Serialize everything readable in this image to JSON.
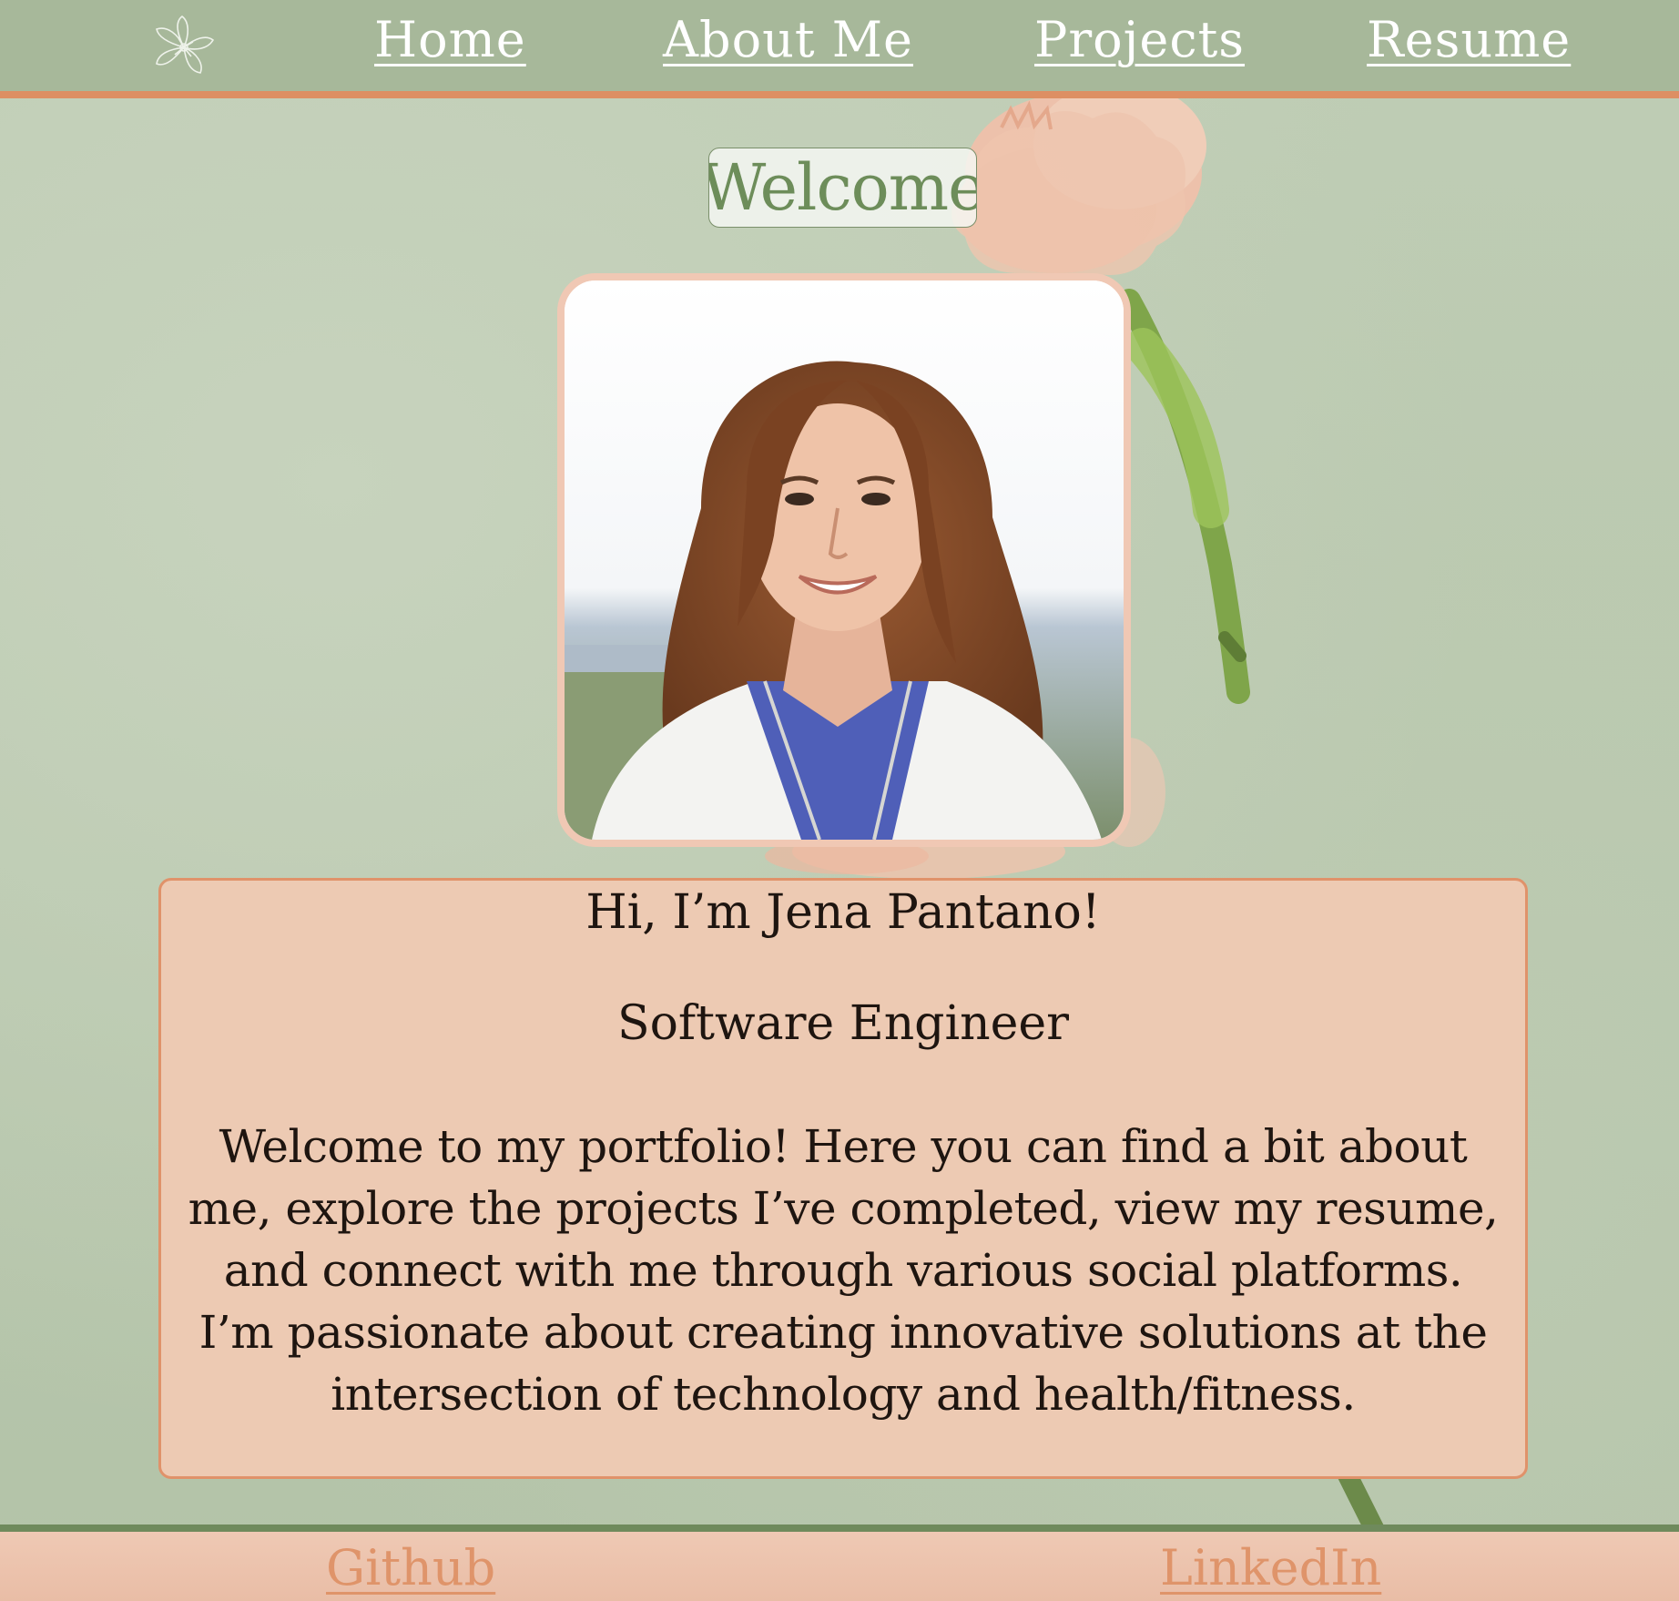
{
  "nav": {
    "logo_icon": "flower-logo-icon",
    "home_label": "Home",
    "about_label": "About Me",
    "projects_label": "Projects",
    "resume_label": "Resume"
  },
  "hero": {
    "welcome_label": "Welcome",
    "portrait_alt": "Jena Pantano portrait"
  },
  "intro": {
    "greeting": "Hi, I’m Jena Pantano!",
    "role": "Software Engineer",
    "body": "Welcome to my portfolio! Here you can find a bit about me, explore the projects I’ve completed, view my resume, and connect with me through various social platforms. I’m passionate about creating innovative solutions at the intersection of technology and health/fitness."
  },
  "footer": {
    "github_label": "Github",
    "linkedin_label": "LinkedIn"
  },
  "colors": {
    "nav_bg": "#a7b89a",
    "accent_orange": "#dd8f63",
    "card_bg": "#edcab3",
    "welcome_text": "#6d8d5a",
    "footer_border": "#6f8a5c"
  }
}
